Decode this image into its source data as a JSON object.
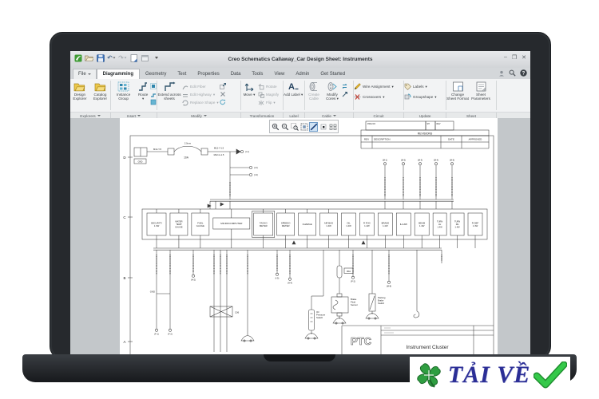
{
  "window": {
    "title": "Creo Schematics Callaway_Car Design Sheet: Instruments"
  },
  "tabs": {
    "file": "File",
    "items": [
      "Diagramming",
      "Geometry",
      "Text",
      "Properties",
      "Data",
      "Tools",
      "View",
      "Admin",
      "Get Started"
    ],
    "active": "Diagramming"
  },
  "ribbon": {
    "groups": [
      "Explorers",
      "Insert",
      "Modify",
      "Transformation",
      "Label",
      "Cable",
      "Circuit",
      "Update",
      "Sheet"
    ],
    "design_explorer": "Design Explorer",
    "catalog_explorer": "Catalog Explorer",
    "instance_group": "Instance Group",
    "route": "Route",
    "extend_across": "Extend across sheets",
    "edit_fiber": "Edit Fiber",
    "edit_highway": "Edit Highway",
    "replace_shape": "Replace Shape",
    "move": "Move",
    "rotate": "Rotate",
    "magnify": "Magnify",
    "flip": "Flip",
    "add_label": "Add Label",
    "create_cable": "Create Cable",
    "modify_cores": "Modify Cores",
    "wire_assignment": "Wire Assignment",
    "crossovers": "Crossovers",
    "labels": "Labels",
    "groupshape": "Groupshape",
    "change_sheet_format": "Change Sheet Format",
    "sheet_parameters": "Sheet Parameters"
  },
  "schematic": {
    "row_letters": [
      "D",
      "C",
      "B",
      "A"
    ],
    "stamp": [
      "DWG NO",
      "SH",
      "REV"
    ],
    "revisions_title": "REVISIONS",
    "revisions_cols": [
      "REV",
      "DESCRIPTION",
      "DATE",
      "APPROVED"
    ],
    "fuse": {
      "gnd": "GND",
      "wire": "M12-Y-5",
      "size": "2.0mm",
      "rating": "10A",
      "wire2": "M12-Y-1.5",
      "wire3": "M12-G-1.5",
      "out": "(I-1)",
      "stubs": [
        "(I-2)",
        "(I-3)"
      ]
    },
    "top_connector_labels": [
      "(M-1)",
      "(M-2)",
      "(M-3)",
      "(M-4)",
      "(M-5)"
    ],
    "cluster": [
      [
        "SECURITY",
        "1.4W"
      ],
      [
        "WATER",
        "TEMP",
        "GAUGE"
      ],
      [
        "FUEL",
        "GAUGE"
      ],
      [
        "MICROCOMPUTER"
      ],
      [
        "TACHO",
        "METER"
      ],
      [
        "SPEEDO",
        "METER"
      ],
      [
        "CHARGE"
      ],
      [
        "AIR BAG",
        "1.4W"
      ],
      [
        "OIL",
        "1.4W"
      ],
      [
        "R FOG",
        "1.4W"
      ],
      [
        "BRAKE",
        "1.4W"
      ],
      [
        "ILLUMI"
      ],
      [
        "BEAM",
        "1.4W"
      ],
      [
        "TURN",
        "LH",
        "1.4W"
      ],
      [
        "TURN",
        "RH",
        "1.4W"
      ],
      [
        "R DEF",
        "1.4W"
      ]
    ],
    "end_labels": [
      "(F-1)",
      "(F-2)",
      "(H-2)",
      "(I-5)",
      "(H-4)",
      "(P-2)",
      "(M-8)"
    ],
    "gnd_branch": "GND",
    "block_label": "C06",
    "inline_fuse": "30A",
    "components": {
      "oil": [
        "Oil",
        "Pressure",
        "Switch"
      ],
      "brake_fluid": [
        "Brake",
        "Fluid",
        "Sensor"
      ],
      "parking": [
        "Parking",
        "Brake",
        "Switch"
      ]
    },
    "title_block": {
      "logo": "PTC",
      "title": "Instrument Cluster"
    }
  },
  "badge": {
    "label": "TẢI VỀ"
  }
}
